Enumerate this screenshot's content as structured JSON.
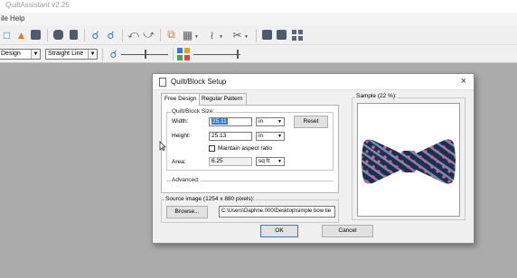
{
  "app": {
    "title": "QuiltAssistant v2.25"
  },
  "menu": {
    "items": [
      {
        "label": "ile"
      },
      {
        "label": "Help"
      }
    ]
  },
  "toolbar": {
    "icons": [
      "new-file-icon",
      "open-folder-icon",
      "save-icon",
      "print-icon",
      "copy-icon",
      "zoom-in-icon",
      "zoom-out-icon",
      "undo-icon",
      "redo-icon",
      "quilt-block-icon",
      "grid-icon",
      "seam-icon",
      "cut-icon",
      "layout-icon",
      "pages-icon",
      "palette-icon"
    ]
  },
  "toolbar2": {
    "mode_select": "Design",
    "line_select": "Straight Line",
    "palette_colors": [
      "#3b78c7",
      "#e0a21f",
      "#4aa54a",
      "#d94a4a"
    ]
  },
  "dialog": {
    "title": "Quilt/Block Setup",
    "close_glyph": "×",
    "tabs": [
      {
        "label": "Free Design",
        "active": true
      },
      {
        "label": "Regular Pattern",
        "active": false
      }
    ],
    "size_group": {
      "label": "Quilt/Block Size:",
      "width_label": "Width:",
      "width_value": "25.11",
      "width_unit": "in",
      "height_label": "Height:",
      "height_value": "25.13",
      "height_unit": "in",
      "reset_label": "Reset",
      "aspect_label": "Maintain aspect ratio",
      "aspect_checked": false,
      "area_label": "Area:",
      "area_value": "6.25",
      "area_unit": "sq ft"
    },
    "advanced_label": "Advanced:",
    "source": {
      "label": "Source image (1254 x 880 pixels):",
      "browse_label": "Browse...",
      "path": "C:\\Users\\Daphne.000\\Desktop\\simple bow tie"
    },
    "sample_label": "Sample (22 %):",
    "ok_label": "OK",
    "cancel_label": "Cancel"
  },
  "colors": {
    "accent": "#3b78c7",
    "bowtie_stripe_dark": "#1e2e4f",
    "bowtie_stripe_light": "#6f8fb3",
    "bowtie_dot": "#e05a8a"
  }
}
